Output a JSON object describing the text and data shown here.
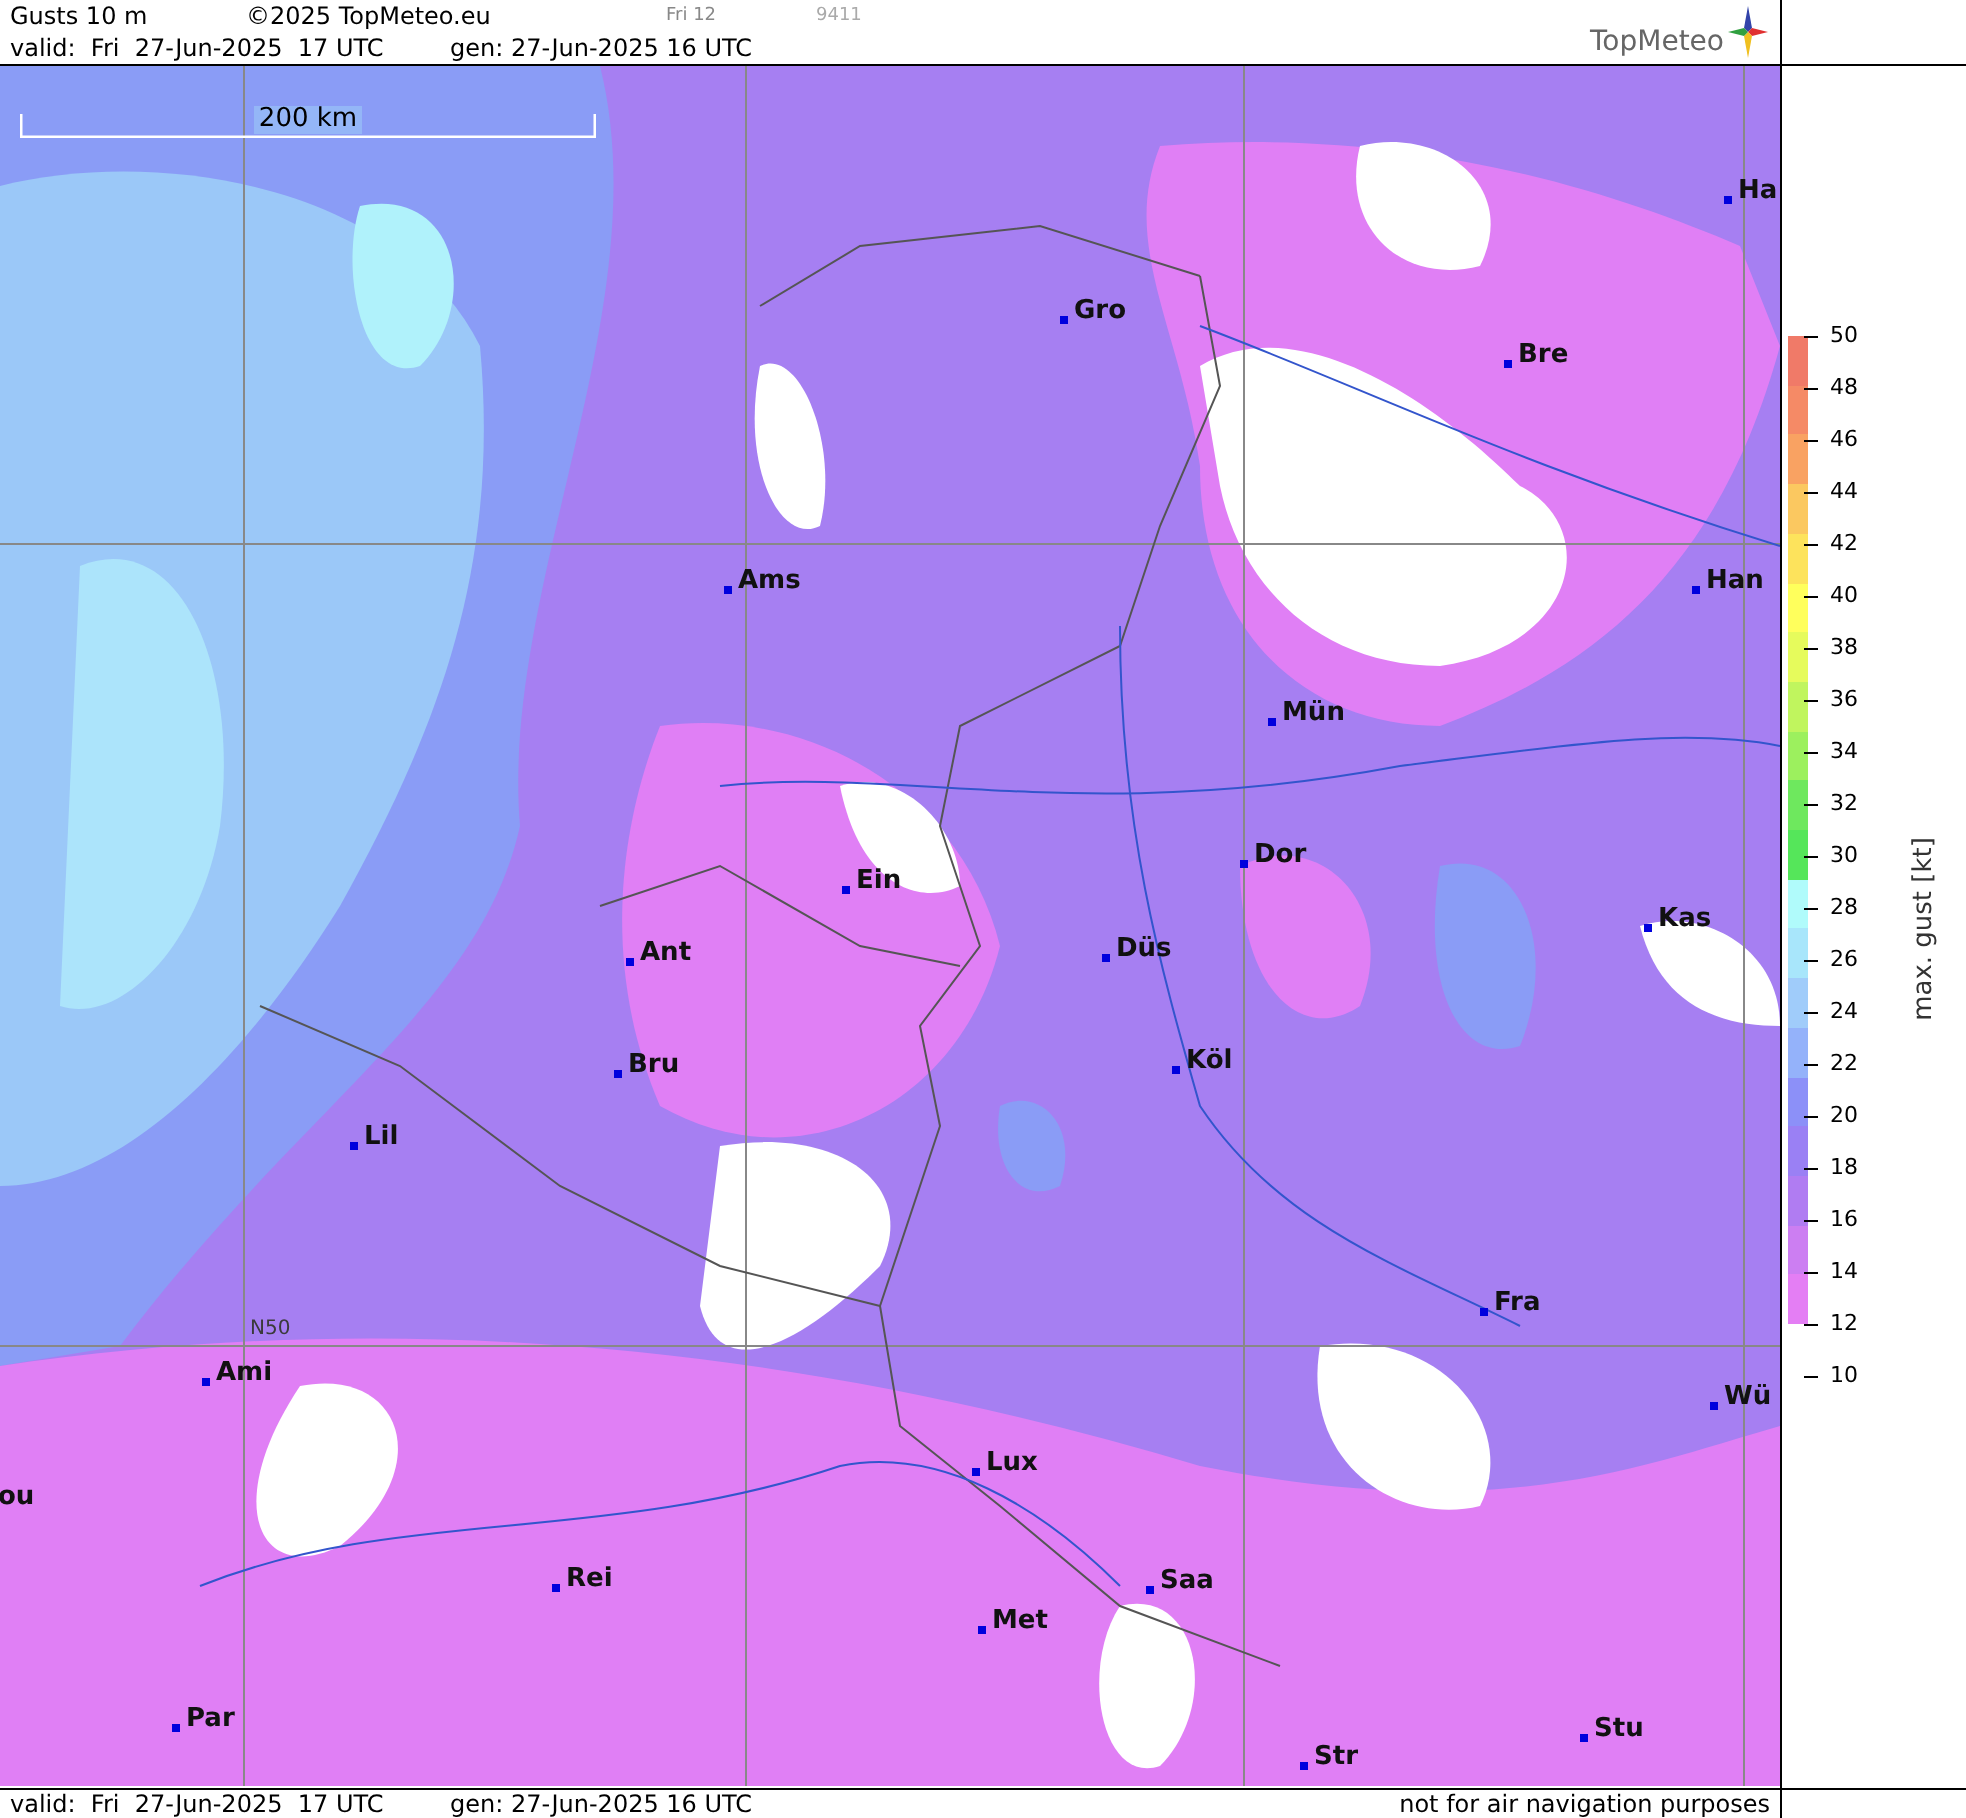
{
  "header": {
    "title": "Gusts 10 m",
    "copyright": "©2025 TopMeteo.eu",
    "run_label": "Fri 12",
    "code": "9411",
    "valid": "valid:  Fri  27-Jun-2025  17 UTC",
    "generated": "gen: 27-Jun-2025 16 UTC",
    "logo": "TopMeteo"
  },
  "map": {
    "scale_label": "200 km",
    "latitude_label": "N50",
    "cities": [
      {
        "name": "Ha"
      },
      {
        "name": "Gro"
      },
      {
        "name": "Bre"
      },
      {
        "name": "Ams"
      },
      {
        "name": "Han"
      },
      {
        "name": "Mün"
      },
      {
        "name": "Dor"
      },
      {
        "name": "Ein"
      },
      {
        "name": "Kas"
      },
      {
        "name": "Düs"
      },
      {
        "name": "Ant"
      },
      {
        "name": "Bru"
      },
      {
        "name": "Köl"
      },
      {
        "name": "Lil"
      },
      {
        "name": "Fra"
      },
      {
        "name": "Ami"
      },
      {
        "name": "Wü"
      },
      {
        "name": "Lux"
      },
      {
        "name": "ou"
      },
      {
        "name": "Rei"
      },
      {
        "name": "Saa"
      },
      {
        "name": "Met"
      },
      {
        "name": "Par"
      },
      {
        "name": "Stu"
      },
      {
        "name": "Str"
      }
    ]
  },
  "legend": {
    "title": "max. gust [kt]",
    "ticks": [
      "50",
      "48",
      "46",
      "44",
      "42",
      "40",
      "38",
      "36",
      "34",
      "32",
      "30",
      "28",
      "26",
      "24",
      "22",
      "20",
      "18",
      "16",
      "14",
      "12",
      "10"
    ]
  },
  "footer": {
    "valid": "valid:  Fri  27-Jun-2025  17 UTC",
    "generated": "gen: 27-Jun-2025 16 UTC",
    "disclaimer": "not for air navigation purposes"
  }
}
